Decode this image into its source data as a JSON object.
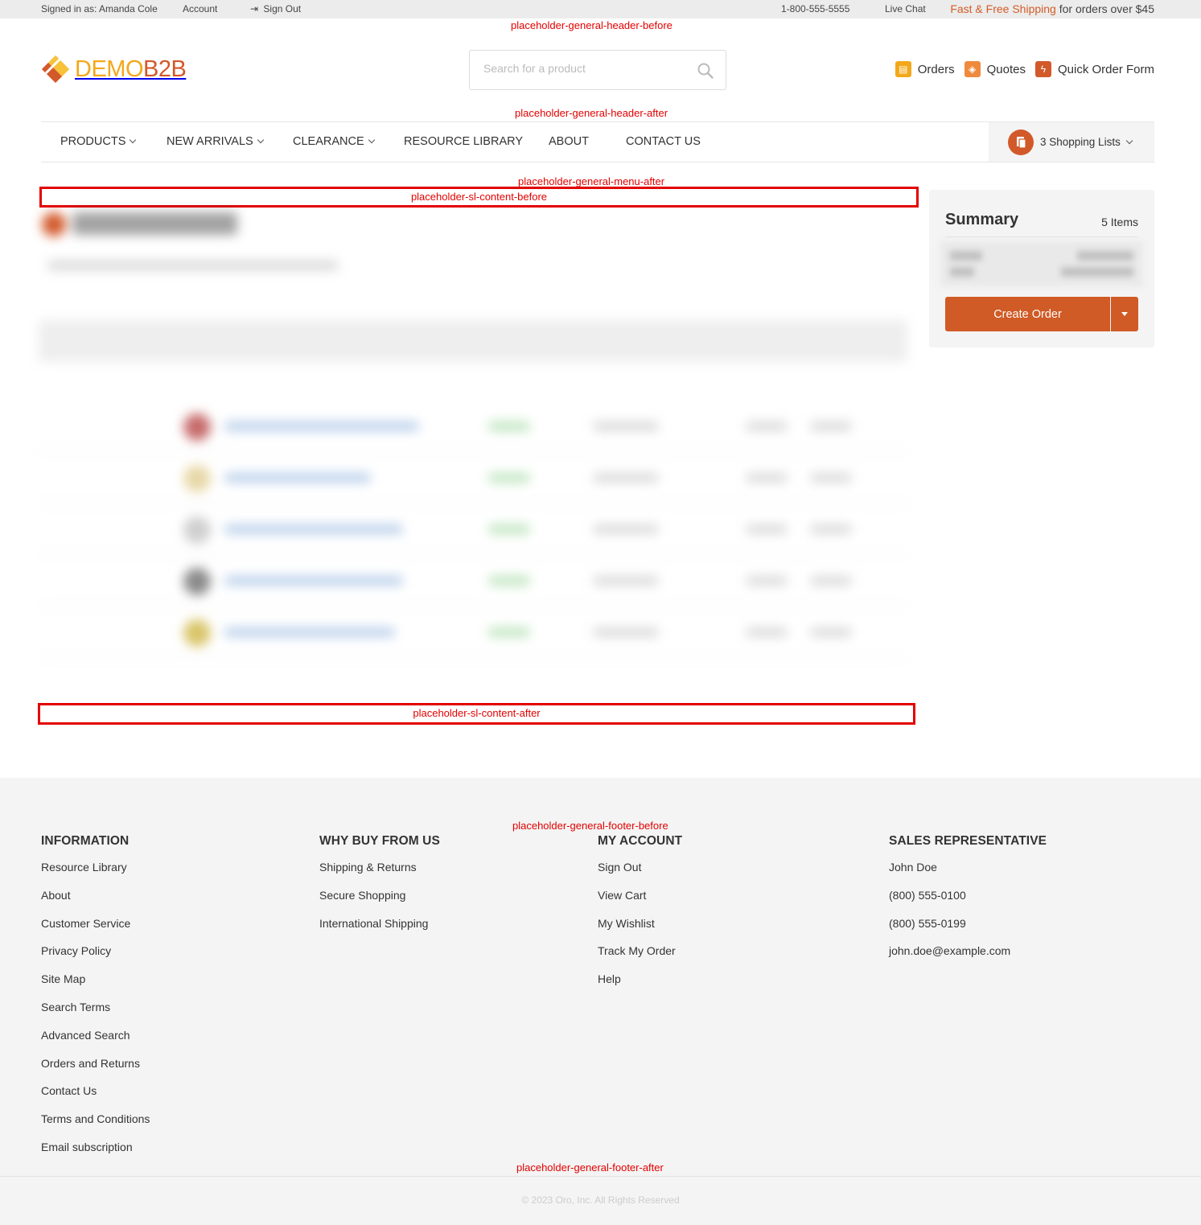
{
  "topbar": {
    "signed_in": "Signed in as: Amanda Cole",
    "account": "Account",
    "sign_out": "Sign Out",
    "phone": "1-800-555-5555",
    "live_chat": "Live Chat",
    "promo_accent": "Fast & Free Shipping",
    "promo_rest": " for orders over $45"
  },
  "placeholders": {
    "header_before": "placeholder-general-header-before",
    "header_after": "placeholder-general-header-after",
    "menu_after": "placeholder-general-menu-after",
    "sl_content_before": "placeholder-sl-content-before",
    "sl_content_after": "placeholder-sl-content-after",
    "footer_before": "placeholder-general-footer-before",
    "footer_after": "placeholder-general-footer-after"
  },
  "header": {
    "logo_part1": "DEMO",
    "logo_part2": "B2B",
    "search_placeholder": "Search for a product",
    "links": {
      "orders": "Orders",
      "quotes": "Quotes",
      "quick_order": "Quick Order Form"
    }
  },
  "menu": {
    "products": "PRODUCTS",
    "new_arrivals": "NEW ARRIVALS",
    "clearance": "CLEARANCE",
    "resource_library": "RESOURCE LIBRARY",
    "about": "ABOUT",
    "contact_us": "CONTACT US",
    "shopping_lists": "3 Shopping Lists"
  },
  "summary": {
    "title": "Summary",
    "count": "5 Items",
    "create_order": "Create Order"
  },
  "footer": {
    "information": {
      "title": "INFORMATION",
      "links": [
        "Resource Library",
        "About",
        "Customer Service",
        "Privacy Policy",
        "Site Map",
        "Search Terms",
        "Advanced Search",
        "Orders and Returns",
        "Contact Us",
        "Terms and Conditions",
        "Email subscription"
      ]
    },
    "why_buy": {
      "title": "WHY BUY FROM US",
      "links": [
        "Shipping & Returns",
        "Secure Shopping",
        "International Shipping"
      ]
    },
    "my_account": {
      "title": "MY ACCOUNT",
      "links": [
        "Sign Out",
        "View Cart",
        "My Wishlist",
        "Track My Order",
        "Help"
      ]
    },
    "sales_rep": {
      "title": "SALES REPRESENTATIVE",
      "lines": [
        "John Doe",
        "(800) 555-0100",
        "(800) 555-0199",
        "john.doe@example.com"
      ]
    },
    "copyright": "© 2023 Oro, Inc. All Rights Reserved"
  },
  "colors": {
    "brand_orange": "#d05b26",
    "brand_yellow": "#f3a81a",
    "placeholder_red": "#e30000"
  }
}
